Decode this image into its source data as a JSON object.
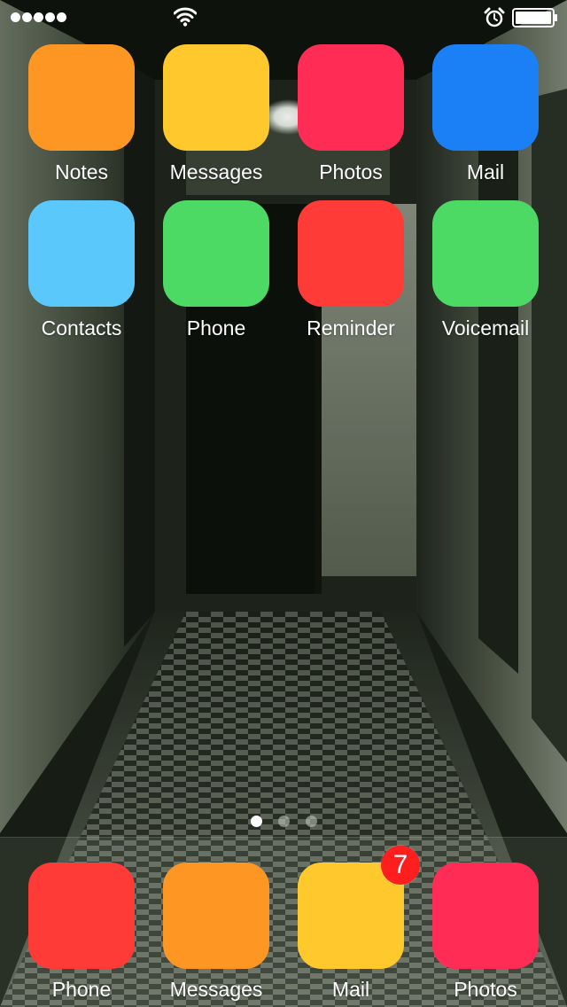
{
  "status_bar": {
    "signal_strength_bars": 5,
    "wifi_icon": "wifi-icon",
    "alarm_icon": "alarm-clock-icon",
    "battery_level": 1.0
  },
  "home_apps": [
    {
      "label": "Notes",
      "color": "#fe9623"
    },
    {
      "label": "Messages",
      "color": "#ffc82c"
    },
    {
      "label": "Photos",
      "color": "#ff2d55"
    },
    {
      "label": "Mail",
      "color": "#1b7ff5"
    },
    {
      "label": "Contacts",
      "color": "#5ac8fa"
    },
    {
      "label": "Phone",
      "color": "#4cd964"
    },
    {
      "label": "Reminder",
      "color": "#ff3b37"
    },
    {
      "label": "Voicemail",
      "color": "#4cd964"
    }
  ],
  "page_indicator": {
    "total_pages": 3,
    "current_page": 1
  },
  "dock_apps": [
    {
      "label": "Phone",
      "color": "#ff3b37"
    },
    {
      "label": "Messages",
      "color": "#fe9623"
    },
    {
      "label": "Mail",
      "color": "#ffc82c",
      "badge": "7"
    },
    {
      "label": "Photos",
      "color": "#ff2d55"
    }
  ]
}
